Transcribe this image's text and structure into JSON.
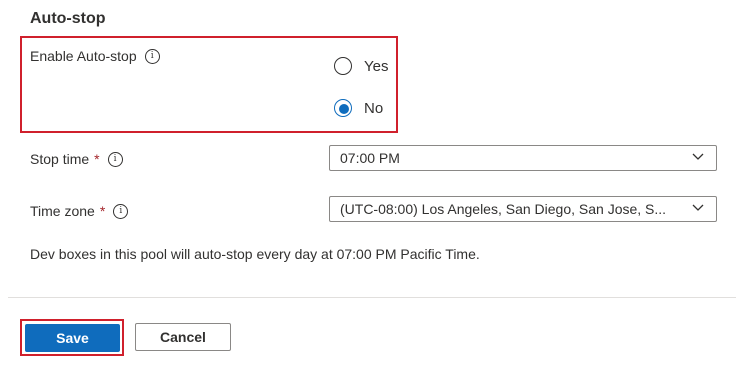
{
  "autostop": {
    "section_title": "Auto-stop",
    "enable_label": "Enable Auto-stop",
    "options": {
      "yes_label": "Yes",
      "no_label": "No",
      "selected": "No"
    },
    "stop_time": {
      "label": "Stop time",
      "required_marker": "*",
      "value": "07:00 PM"
    },
    "time_zone": {
      "label": "Time zone",
      "required_marker": "*",
      "value": "(UTC-08:00) Los Angeles, San Diego, San Jose, S..."
    },
    "info_text": "Dev boxes in this pool will auto-stop every day at 07:00 PM Pacific Time."
  },
  "icons": {
    "info": "info-icon",
    "chevron": "chevron-down-icon"
  },
  "colors": {
    "accent": "#0f6cbd",
    "highlight": "#d0202c",
    "required": "#a4262c"
  },
  "footer": {
    "save_label": "Save",
    "cancel_label": "Cancel"
  }
}
